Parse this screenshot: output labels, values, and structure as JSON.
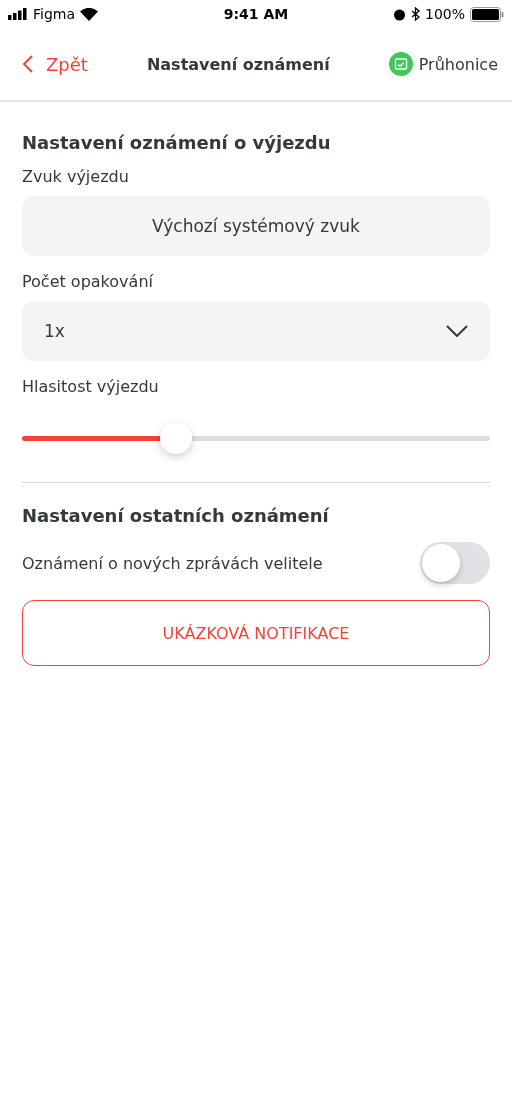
{
  "status_bar": {
    "carrier": "Figma",
    "time": "9:41 AM",
    "battery": "100%"
  },
  "nav": {
    "back": "Zpět",
    "title": "Nastavení oznámení",
    "station": "Průhonice"
  },
  "dispatch_section": {
    "heading": "Nastavení oznámení o výjezdu",
    "sound": {
      "label": "Zvuk výjezdu",
      "value": "Výchozí systémový zvuk"
    },
    "repeat": {
      "label": "Počet opakování",
      "value": "1x"
    },
    "volume": {
      "label": "Hlasitost výjezdu",
      "level": 0.33
    }
  },
  "other_section": {
    "heading": "Nastavení ostatních oznámení",
    "toggles": [
      {
        "label": "Oznámení o nových zprávách velitele",
        "on": false
      }
    ]
  },
  "sample_button": "UKÁZKOVÁ NOTIFIKACE"
}
